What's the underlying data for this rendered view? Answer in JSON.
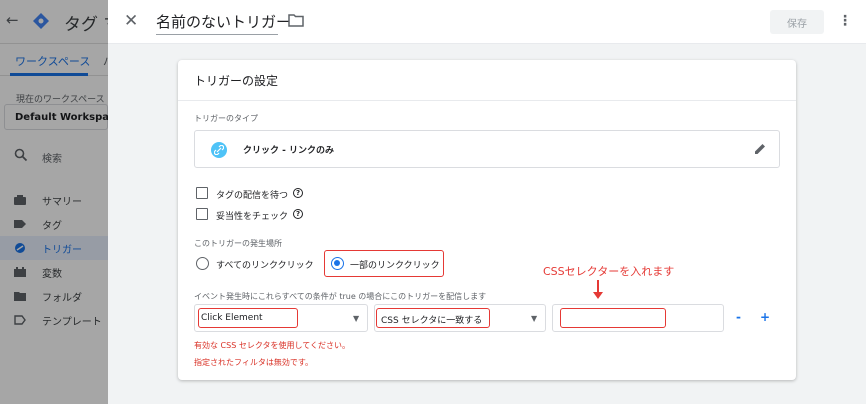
{
  "bg": {
    "title": "タグ マ",
    "tab_workspace": "ワークスペース",
    "tab_other": "バ",
    "workspace_label": "現在のワークスペース",
    "workspace_name": "Default Workspace",
    "search_placeholder": "検索",
    "nav": [
      {
        "label": "サマリー"
      },
      {
        "label": "タグ"
      },
      {
        "label": "トリガー"
      },
      {
        "label": "変数"
      },
      {
        "label": "フォルダ"
      },
      {
        "label": "テンプレート"
      }
    ]
  },
  "header": {
    "title": "名前のないトリガー",
    "save_label": "保存"
  },
  "card": {
    "title": "トリガーの設定",
    "type_label": "トリガーのタイプ",
    "type_name": "クリック - リンクのみ",
    "checkbox_wait": "タグの配信を待つ",
    "checkbox_validate": "妥当性をチェック",
    "fire_label": "このトリガーの発生場所",
    "radio_all": "すべてのリンククリック",
    "radio_some": "一部のリンククリック",
    "condition_label": "イベント発生時にこれらすべての条件が true の場合にこのトリガーを配信します",
    "variable_value": "Click Element",
    "operator_value": "CSS セレクタに一致する",
    "value_value": "",
    "annotation": "CSSセレクターを入れます",
    "minus_label": "-",
    "plus_label": "+",
    "error1": "有効な CSS セレクタを使用してください。",
    "error2": "指定されたフィルタは無効です。"
  },
  "colors": {
    "accent": "#1a73e8",
    "annotation_red": "#e53935",
    "error_red": "#d93025"
  }
}
